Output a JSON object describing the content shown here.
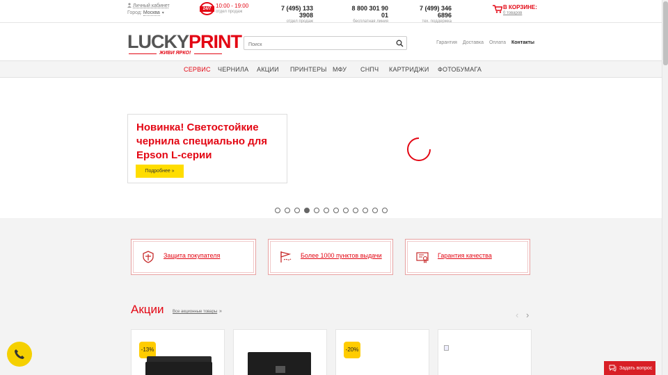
{
  "topbar": {
    "account_label": "Личный кабинет",
    "city_label": "Город:",
    "city_value": "Москва",
    "badge": "24/7",
    "hours": "10:00 - 19:00",
    "hours_sub": "отдел продаж",
    "phones": [
      {
        "number": "7 (495) 133 3908",
        "label": "отдел продаж"
      },
      {
        "number": "8 800 301 90 01",
        "label": "бесплатная линия"
      },
      {
        "number": "7 (499) 346 6896",
        "label": "тех. поддержка"
      }
    ],
    "cart_title": "В КОРЗИНЕ:",
    "cart_count": "0 товаров"
  },
  "header": {
    "logo_lucky": "LUCKY",
    "logo_print": "PRINT",
    "logo_tagline": "ЖИВИ ЯРКО!",
    "search_placeholder": "Поиск",
    "links": [
      "Гарантия",
      "Доставка",
      "Оплата",
      "Контакты"
    ]
  },
  "nav": {
    "items": [
      "СЕРВИС",
      "ЧЕРНИЛА",
      "АКЦИИ",
      "ПРИНТЕРЫ",
      "МФУ",
      "СНПЧ",
      "КАРТРИДЖИ",
      "ФОТОБУМАГА"
    ],
    "active_index": 0
  },
  "hero": {
    "promo_title": "Новинка! Светостойкие чернила специально для Epson L-серии",
    "promo_button": "Подробнее »",
    "slide_count": 12,
    "active_slide": 3
  },
  "features": [
    {
      "text": "Защита покупателя",
      "icon": "shield-icon"
    },
    {
      "text": "Более 1000 пунктов выдачи",
      "icon": "flag-route-icon"
    },
    {
      "text": "Гарантия качества",
      "icon": "certificate-icon"
    }
  ],
  "sales": {
    "title": "Акции",
    "all_link": "Все акционные товары",
    "all_arrow": "»",
    "products": [
      {
        "discount": "-13%"
      },
      {
        "discount": ""
      },
      {
        "discount": "-20%"
      },
      {
        "discount": ""
      }
    ]
  },
  "floating": {
    "ask_button": "Задать вопрос"
  },
  "colors": {
    "brand_red": "#e30613",
    "accent_yellow": "#ffdd00"
  }
}
